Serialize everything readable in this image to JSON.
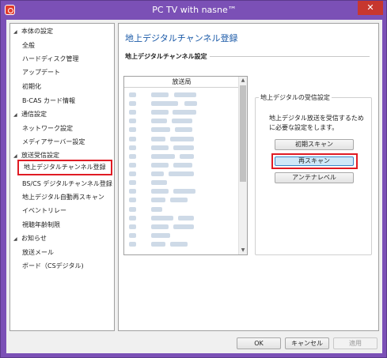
{
  "window": {
    "title": "PC TV with nasne™",
    "close_label": "✕"
  },
  "sidebar": {
    "groups": [
      {
        "label": "本体の設定",
        "items": [
          "全般",
          "ハードディスク管理",
          "アップデート",
          "初期化",
          "B-CAS カード情報"
        ]
      },
      {
        "label": "通信設定",
        "items": [
          "ネットワーク設定",
          "メディアサーバー設定"
        ]
      },
      {
        "label": "放送受信設定",
        "items": [
          "地上デジタルチャンネル登録",
          "BS/CS デジタルチャンネル登録",
          "地上デジタル自動再スキャン",
          "イベントリレー",
          "視聴年齢制限"
        ]
      },
      {
        "label": "お知らせ",
        "items": [
          "放送メール",
          "ボード（CSデジタル)"
        ]
      }
    ],
    "selected": "地上デジタルチャンネル登録"
  },
  "main": {
    "page_title": "地上デジタルチャンネル登録",
    "section_title": "地上デジタルチャンネル設定",
    "list_header": "放送局",
    "group_title": "地上デジタルの受信設定",
    "group_desc": "地上デジタル放送を受信するために必要な設定をします。",
    "buttons": {
      "initial_scan": "初期スキャン",
      "rescan": "再スキャン",
      "antenna_level": "アンテナレベル"
    }
  },
  "footer": {
    "ok": "OK",
    "cancel": "キャンセル",
    "apply": "適用"
  },
  "colors": {
    "highlight": "#e01b24",
    "title_blue": "#1b5aa8",
    "frame_purple": "#7b50b6"
  }
}
